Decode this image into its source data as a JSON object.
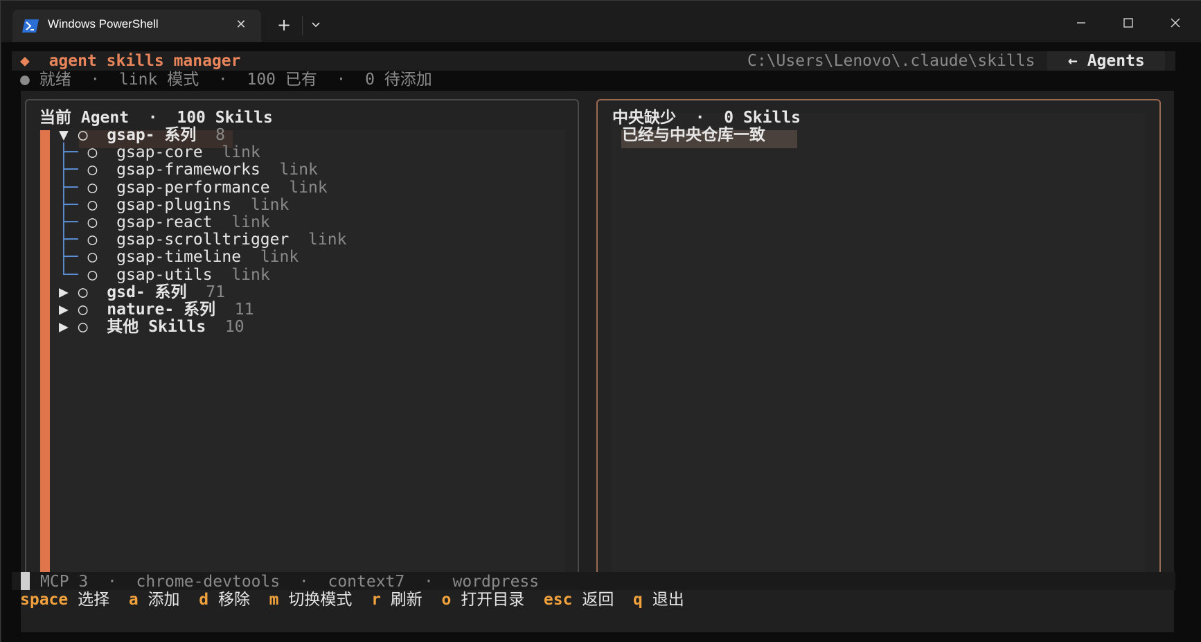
{
  "window": {
    "tab_title": "Windows PowerShell",
    "tab_close": "✕",
    "new_tab": "+"
  },
  "header": {
    "app_title": "agent skills manager",
    "path": "C:\\Users\\Lenovo\\.claude\\skills",
    "back_label": "← Agents"
  },
  "status_line": {
    "dot": "●",
    "state": "就绪",
    "mode": "link 模式",
    "existing": "100 已有",
    "pending": "0 待添加"
  },
  "left_panel": {
    "title": "当前 Agent",
    "count": "100 Skills",
    "groups": [
      {
        "name": "gsap- 系列",
        "count": "8",
        "expanded": true,
        "items": [
          {
            "name": "gsap-core",
            "type": "link"
          },
          {
            "name": "gsap-frameworks",
            "type": "link"
          },
          {
            "name": "gsap-performance",
            "type": "link"
          },
          {
            "name": "gsap-plugins",
            "type": "link"
          },
          {
            "name": "gsap-react",
            "type": "link"
          },
          {
            "name": "gsap-scrolltrigger",
            "type": "link"
          },
          {
            "name": "gsap-timeline",
            "type": "link"
          },
          {
            "name": "gsap-utils",
            "type": "link"
          }
        ]
      },
      {
        "name": "gsd- 系列",
        "count": "71",
        "expanded": false
      },
      {
        "name": "nature- 系列",
        "count": "11",
        "expanded": false
      },
      {
        "name": "其他 Skills",
        "count": "10",
        "expanded": false
      }
    ]
  },
  "right_panel": {
    "title": "中央缺少",
    "count": "0 Skills",
    "message": "已经与中央仓库一致"
  },
  "mcp_line": {
    "label": "MCP 3",
    "servers": [
      "chrome-devtools",
      "context7",
      "wordpress"
    ]
  },
  "shortcuts": [
    {
      "key": "space",
      "label": "选择"
    },
    {
      "key": "a",
      "label": "添加"
    },
    {
      "key": "d",
      "label": "移除"
    },
    {
      "key": "m",
      "label": "切换模式"
    },
    {
      "key": "r",
      "label": "刷新"
    },
    {
      "key": "o",
      "label": "打开目录"
    },
    {
      "key": "esc",
      "label": "返回"
    },
    {
      "key": "q",
      "label": "退出"
    }
  ],
  "colors": {
    "accent": "#e8855a",
    "key": "#f2a23c",
    "tree": "#5b8fd6"
  }
}
